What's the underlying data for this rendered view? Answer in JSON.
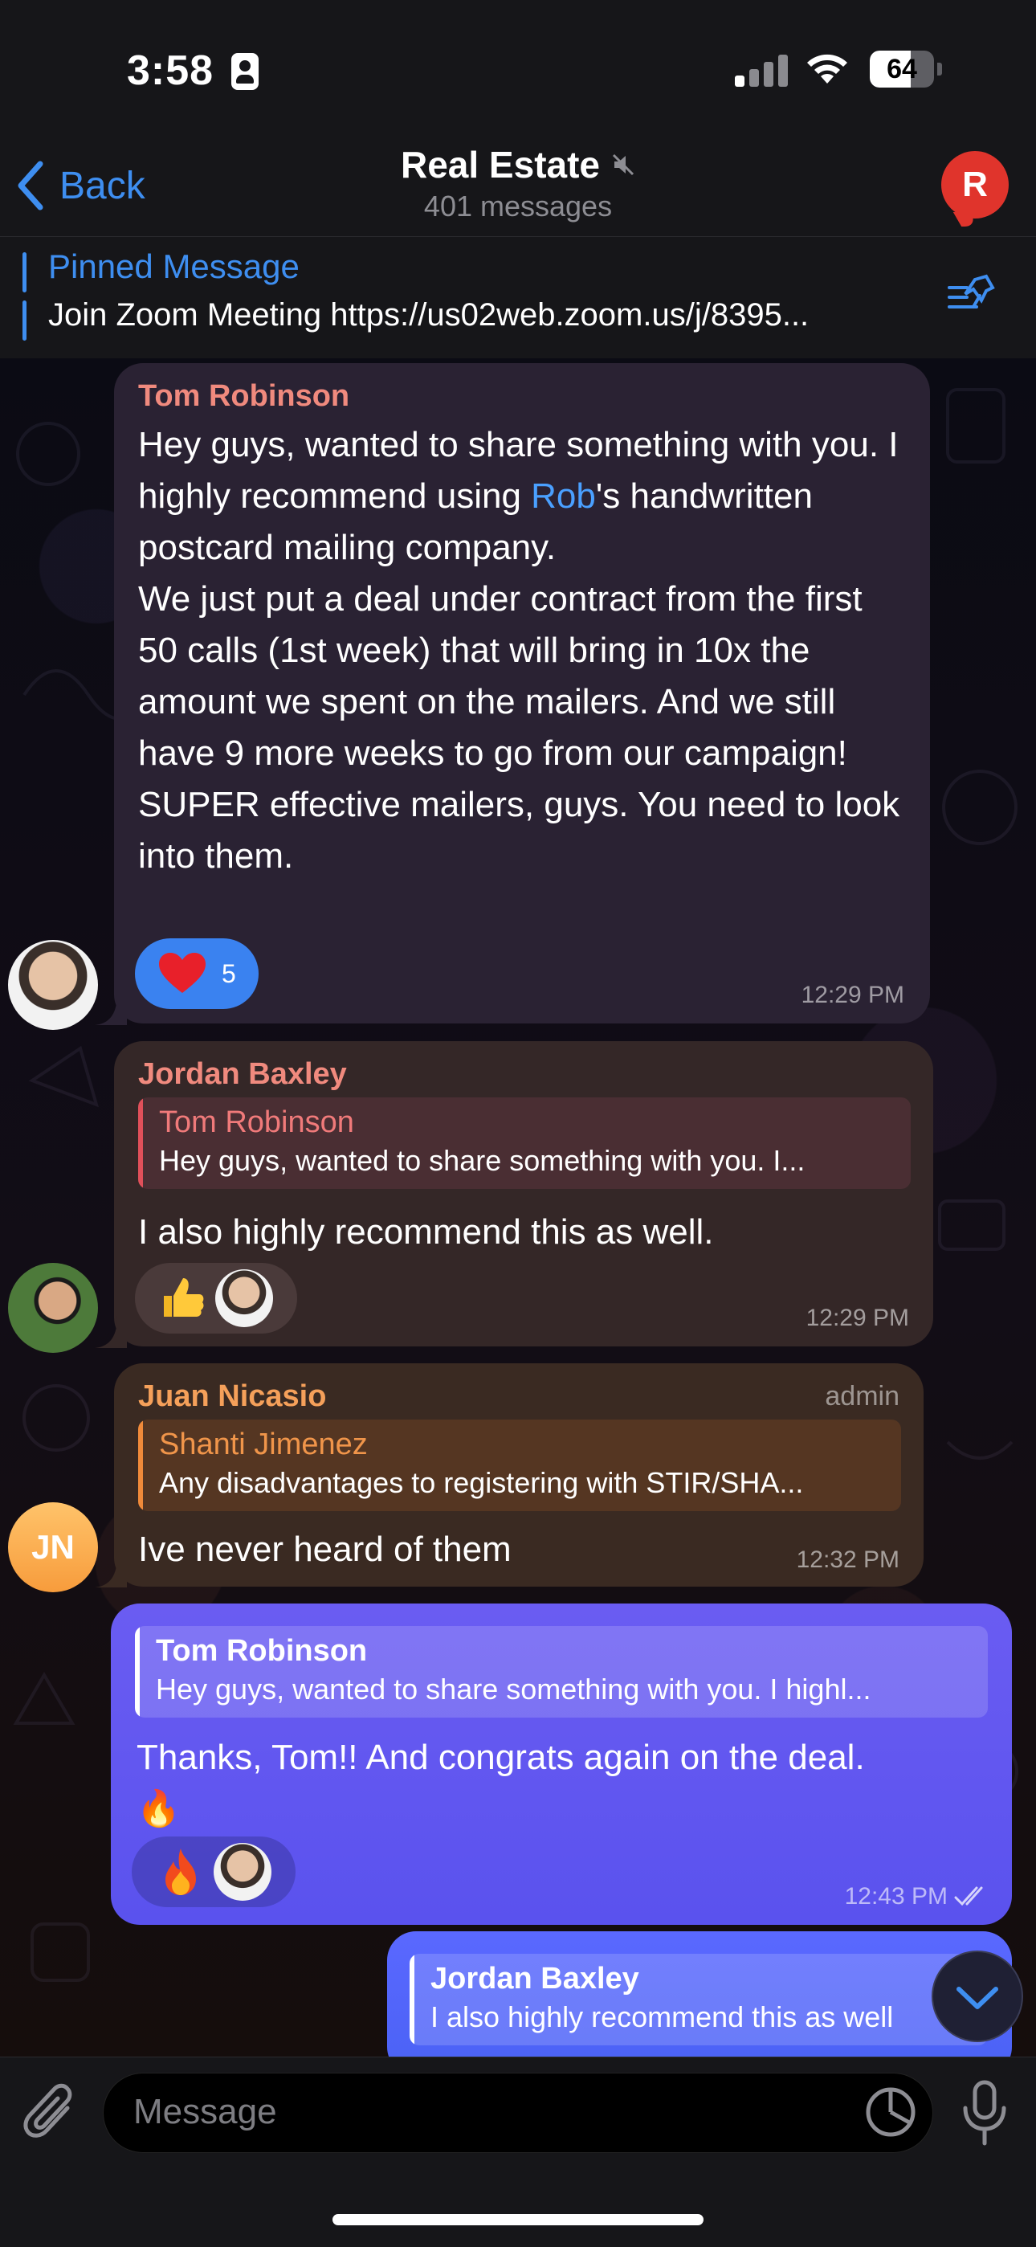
{
  "status_bar": {
    "time": "3:58",
    "battery": "64",
    "battery_level": 0.64
  },
  "header": {
    "back_label": "Back",
    "title": "Real Estate",
    "subtitle": "401 messages",
    "avatar_letter": "R",
    "avatar_color": "#e0342c"
  },
  "pinned": {
    "label": "Pinned Message",
    "text": "Join Zoom Meeting https://us02web.zoom.us/j/8395..."
  },
  "messages": [
    {
      "sender": "Tom Robinson",
      "sender_color": "#f08a7e",
      "text_before_link": "Hey guys, wanted to share something with you. I highly recommend using ",
      "link": "Rob",
      "text_after_link": "'s handwritten postcard mailing company.\nWe just put a deal under contract from the first 50 calls (1st week) that will bring in 10x the amount we spent on the mailers. And we still have 9 more weeks to go from our campaign!\nSUPER effective mailers, guys. You need to look into them.",
      "reaction_count": "5",
      "time": "12:29 PM"
    },
    {
      "sender": "Jordan Baxley",
      "sender_color": "#f08a7e",
      "reply_name": "Tom Robinson",
      "reply_text": "Hey guys, wanted to share something with you. I...",
      "text": "I also highly recommend this as well.",
      "time": "12:29 PM"
    },
    {
      "sender": "Juan Nicasio",
      "sender_color": "#f5a05a",
      "badge": "admin",
      "avatar_initials": "JN",
      "reply_name": "Shanti Jimenez",
      "reply_text": "Any disadvantages to registering with STIR/SHA...",
      "text": "Ive never heard of them",
      "time": "12:32 PM"
    },
    {
      "reply_name": "Tom Robinson",
      "reply_text": "Hey guys, wanted to share something with you. I highl...",
      "text": "Thanks, Tom!! And congrats again on the deal.",
      "emoji": "🔥",
      "time": "12:43 PM"
    },
    {
      "reply_name": "Jordan Baxley",
      "reply_text": "I also highly recommend this as well"
    }
  ],
  "composer": {
    "placeholder": "Message"
  },
  "colors": {
    "accent": "#3e8ef0",
    "outgoing_bubble": "#5a52ee",
    "incoming_bubble": "#2a2233"
  }
}
